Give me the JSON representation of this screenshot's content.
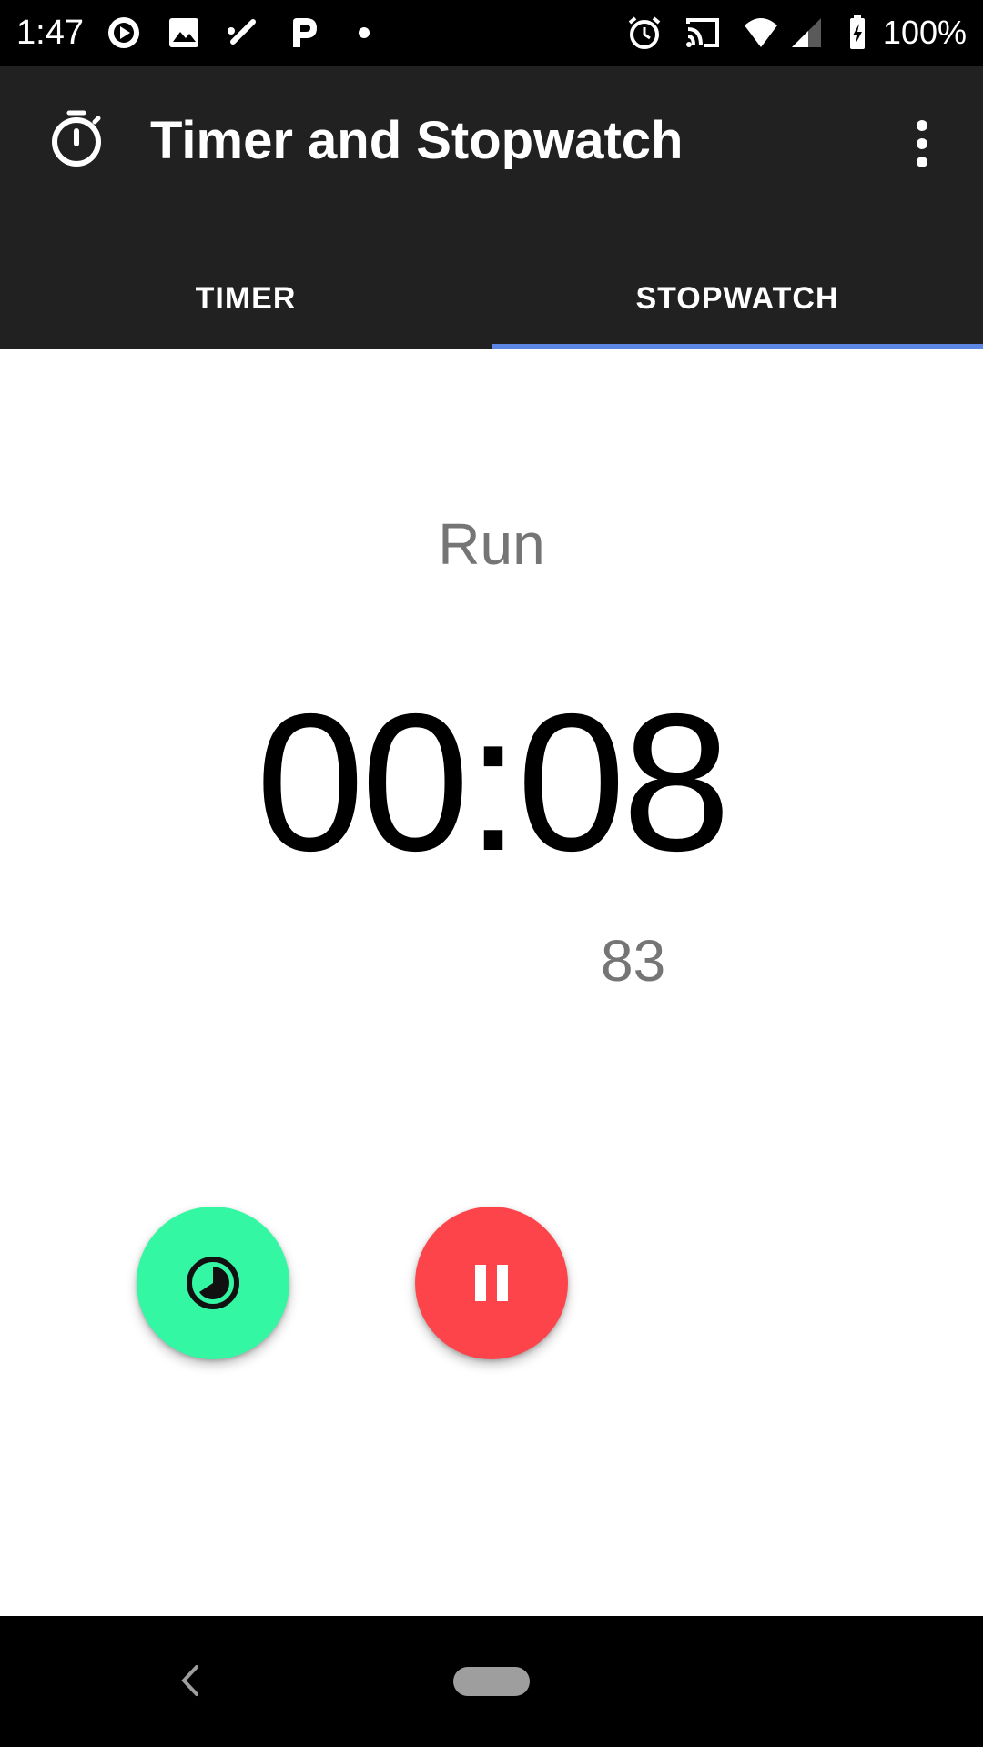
{
  "status_bar": {
    "time": "1:47",
    "battery": "100%",
    "icons": [
      "play-circle-icon",
      "image-icon",
      "tool-icon",
      "parking-icon",
      "dot-icon",
      "alarm-icon",
      "cast-icon",
      "wifi-icon",
      "signal-icon",
      "battery-charging-icon"
    ]
  },
  "app_bar": {
    "title": "Timer and Stopwatch",
    "icon": "stopwatch-icon",
    "menu_icon": "overflow-menu-icon"
  },
  "tabs": [
    {
      "label": "TIMER",
      "active": false
    },
    {
      "label": "STOPWATCH",
      "active": true
    }
  ],
  "stopwatch": {
    "state": "Run",
    "time": "00:08",
    "centiseconds": "83"
  },
  "buttons": {
    "lap_icon": "lap-icon",
    "pause_icon": "pause-icon"
  },
  "colors": {
    "accent": "#5b86e5",
    "lap_button": "#33f7a3",
    "pause_button": "#fd444a",
    "app_bar": "#212121"
  }
}
